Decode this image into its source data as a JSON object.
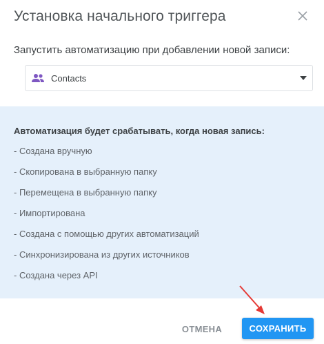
{
  "dialog": {
    "title": "Установка начального триггера",
    "close_icon": "close-icon"
  },
  "trigger": {
    "label": "Запустить автоматизацию при добавлении новой записи:",
    "select_value": "Contacts",
    "select_icon": "people-icon",
    "dropdown_icon": "caret-down-icon"
  },
  "info": {
    "title": "Автоматизация будет срабатывать, когда новая запись:",
    "items": [
      "- Создана вручную",
      "- Скопирована в выбранную папку",
      "- Перемещена в выбранную папку",
      "- Импортирована",
      "- Создана с помощью других автоматизаций",
      "- Синхронизирована из других источников",
      "- Создана через API"
    ]
  },
  "actions": {
    "cancel_label": "ОТМЕНА",
    "save_label": "СОХРАНИТЬ"
  },
  "colors": {
    "accent": "#2196f3",
    "info_background": "#e5f0fb",
    "icon_purple": "#7e57c2",
    "annotation_arrow": "#e53935"
  }
}
